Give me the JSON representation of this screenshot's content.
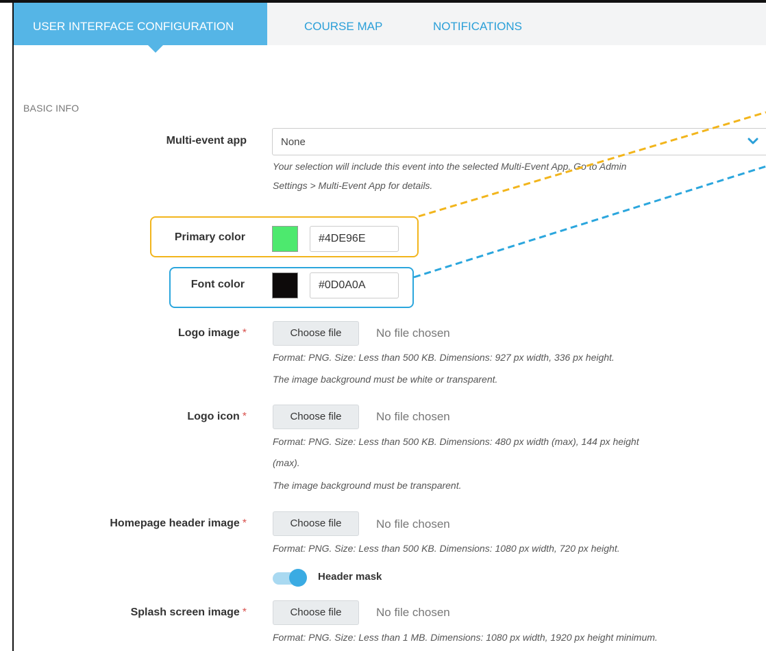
{
  "tabs": [
    {
      "label": "USER INTERFACE CONFIGURATION",
      "active": true
    },
    {
      "label": "COURSE MAP",
      "active": false
    },
    {
      "label": "NOTIFICATIONS",
      "active": false
    }
  ],
  "section": {
    "title": "BASIC INFO"
  },
  "multi_event": {
    "label": "Multi-event app",
    "value": "None",
    "help_line1": "Your selection will include this event into the selected Multi-Event App. Go to Admin",
    "help_line2": "Settings > Multi-Event App for details."
  },
  "primary_color": {
    "label": "Primary color",
    "hex": "#4DE96E",
    "swatch": "#4DE96E"
  },
  "font_color": {
    "label": "Font color",
    "hex": "#0D0A0A",
    "swatch": "#0D0A0A"
  },
  "logo_image": {
    "label": "Logo image",
    "button": "Choose file",
    "status": "No file chosen",
    "help_line1": "Format: PNG. Size: Less than 500 KB. Dimensions: 927 px width, 336 px height.",
    "help_line2": "The image background must be white or transparent."
  },
  "logo_icon": {
    "label": "Logo icon",
    "button": "Choose file",
    "status": "No file chosen",
    "help_line1": "Format: PNG. Size: Less than 500 KB. Dimensions: 480 px width (max), 144 px height",
    "help_line2": "(max).",
    "help_line3": "The image background must be transparent."
  },
  "homepage_header": {
    "label": "Homepage header image",
    "button": "Choose file",
    "status": "No file chosen",
    "help_line1": "Format: PNG. Size: Less than 500 KB. Dimensions: 1080 px width, 720 px height.",
    "toggle_label": "Header mask",
    "toggle_on": true
  },
  "splash": {
    "label": "Splash screen image",
    "button": "Choose file",
    "status": "No file chosen",
    "help_line1": "Format: PNG. Size: Less than 1 MB. Dimensions: 1080 px width, 1920 px height minimum."
  },
  "required_mark": "*",
  "colors": {
    "accent": "#55b5e6",
    "tab_text": "#2a9fd8",
    "highlight_primary": "#f2b51c",
    "highlight_font": "#2ba6dd",
    "required": "#d9534f"
  }
}
